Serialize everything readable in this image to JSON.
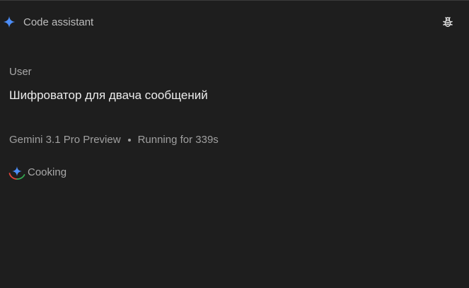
{
  "header": {
    "title": "Code assistant",
    "logo_icon": "sparkle-icon",
    "debug_icon": "bug-icon"
  },
  "conversation": {
    "role": "User",
    "message": "Шифроватор для двача сообщений",
    "model": "Gemini 3.1 Pro Preview",
    "status": "Running for 339s",
    "progress_label": "Cooking",
    "progress_icon": "gemini-spinner-icon"
  },
  "colors": {
    "background": "#1e1e1e",
    "accent_blue": "#4c8df6",
    "spinner_red": "#e0443a",
    "spinner_green": "#34a853"
  }
}
